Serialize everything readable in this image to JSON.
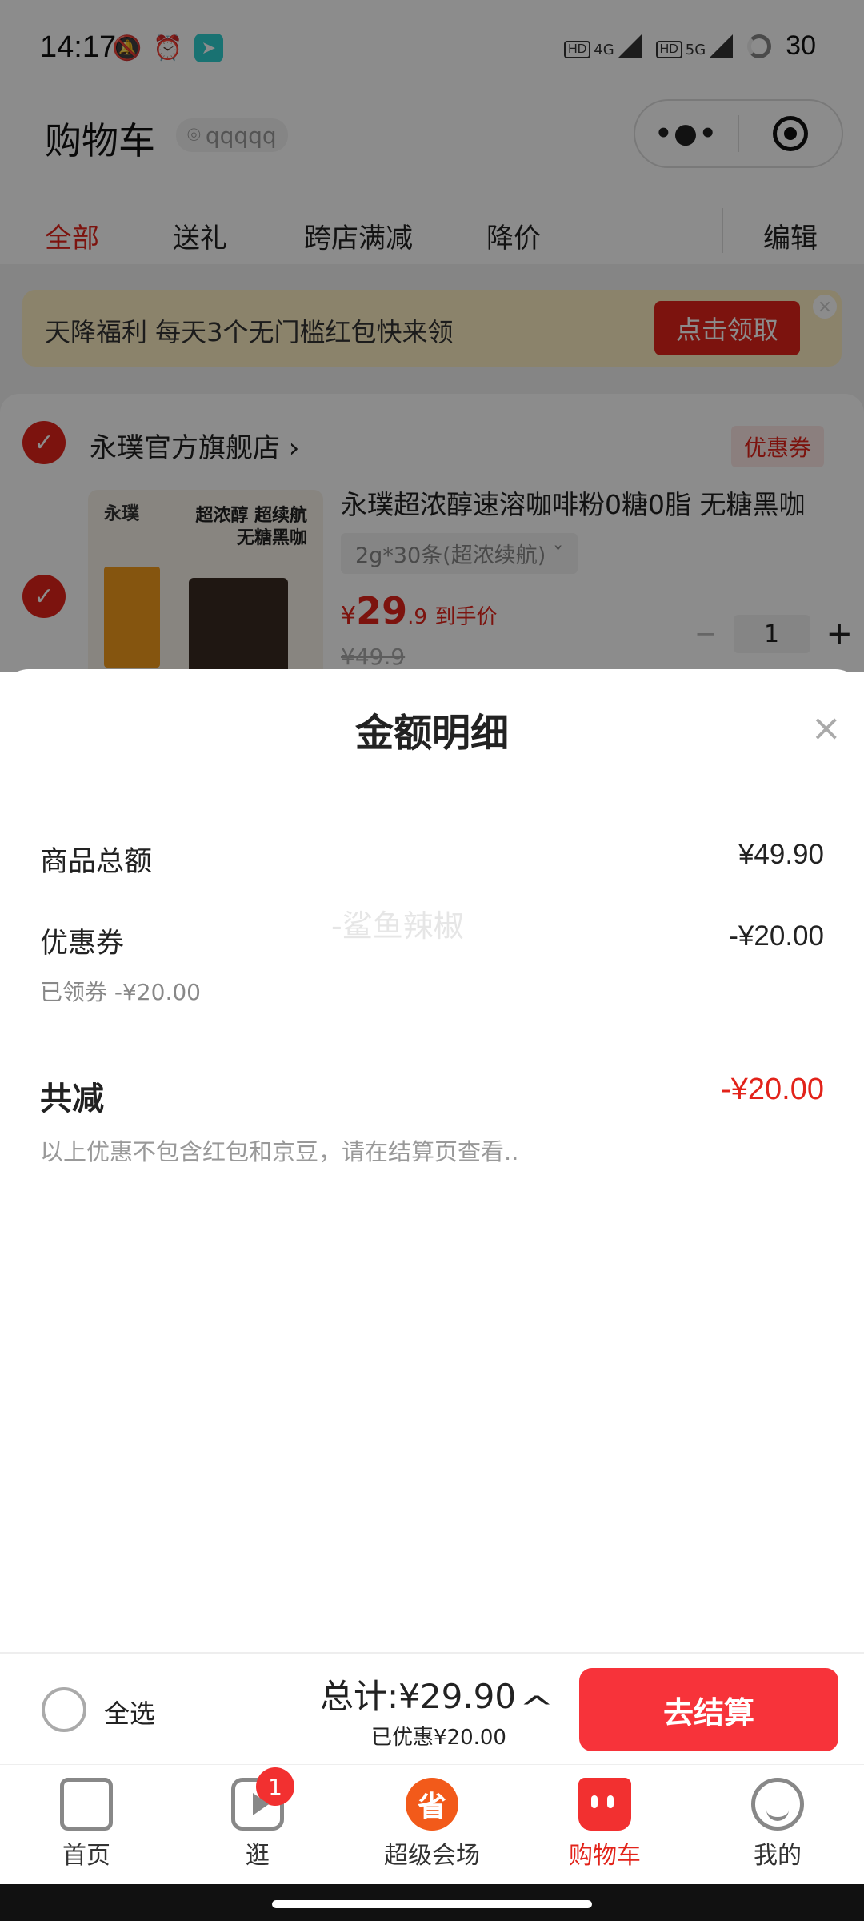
{
  "status_bar": {
    "time": "14:17",
    "network1": "4G",
    "network2": "5G",
    "battery": "30"
  },
  "header": {
    "title": "购物车",
    "location": "qqqqq",
    "capsule_more": "•●•"
  },
  "tabs": [
    {
      "label": "全部",
      "active": true
    },
    {
      "label": "送礼"
    },
    {
      "label": "跨店满减"
    },
    {
      "label": "降价"
    },
    {
      "label": "编辑"
    }
  ],
  "banner": {
    "text": "天降福利 每天3个无门槛红包快来领",
    "button": "点击领取",
    "close": "×"
  },
  "store": {
    "name": "永璞官方旗舰店 ›",
    "coupon_tag": "优惠券",
    "product": {
      "image_brand": "永璞",
      "image_line1": "超浓醇 超续航",
      "image_line2": "无糖黑咖",
      "title": "永璞超浓醇速溶咖啡粉0糖0脂 无糖黑咖",
      "spec": "2g*30条(超浓续航)  ˇ",
      "price_symbol": "¥",
      "price_int": "29",
      "price_dec": ".9",
      "price_note": "到手价",
      "original_price": "¥49.9",
      "quantity": "1",
      "minus": "−",
      "plus": "+"
    }
  },
  "sheet": {
    "title": "金额明细",
    "close": "×",
    "watermark": "-鲨鱼辣椒",
    "goods_total_label": "商品总额",
    "goods_total_value": "¥49.90",
    "coupon_label": "优惠券",
    "coupon_value": "-¥20.00",
    "coupon_note": "已领券 -¥20.00",
    "reduction_label": "共减",
    "reduction_value": "-¥20.00",
    "reduction_note": "以上优惠不包含红包和京豆，请在结算页查看.."
  },
  "bottom": {
    "select_all": "全选",
    "total": "总计:¥29.90",
    "saved": "已优惠¥20.00",
    "caret": "^",
    "checkout": "去结算"
  },
  "tabbar": [
    {
      "label": "首页",
      "icon": "home-icon"
    },
    {
      "label": "逛",
      "icon": "video-icon",
      "badge": "1"
    },
    {
      "label": "超级会场",
      "icon": "super-venue-icon",
      "glyph": "省"
    },
    {
      "label": "购物车",
      "icon": "cart-icon",
      "active": true
    },
    {
      "label": "我的",
      "icon": "profile-icon"
    }
  ],
  "colors": {
    "accent": "#e2231a",
    "checkout": "#f7333a",
    "banner_bg": "#fdeec4"
  }
}
